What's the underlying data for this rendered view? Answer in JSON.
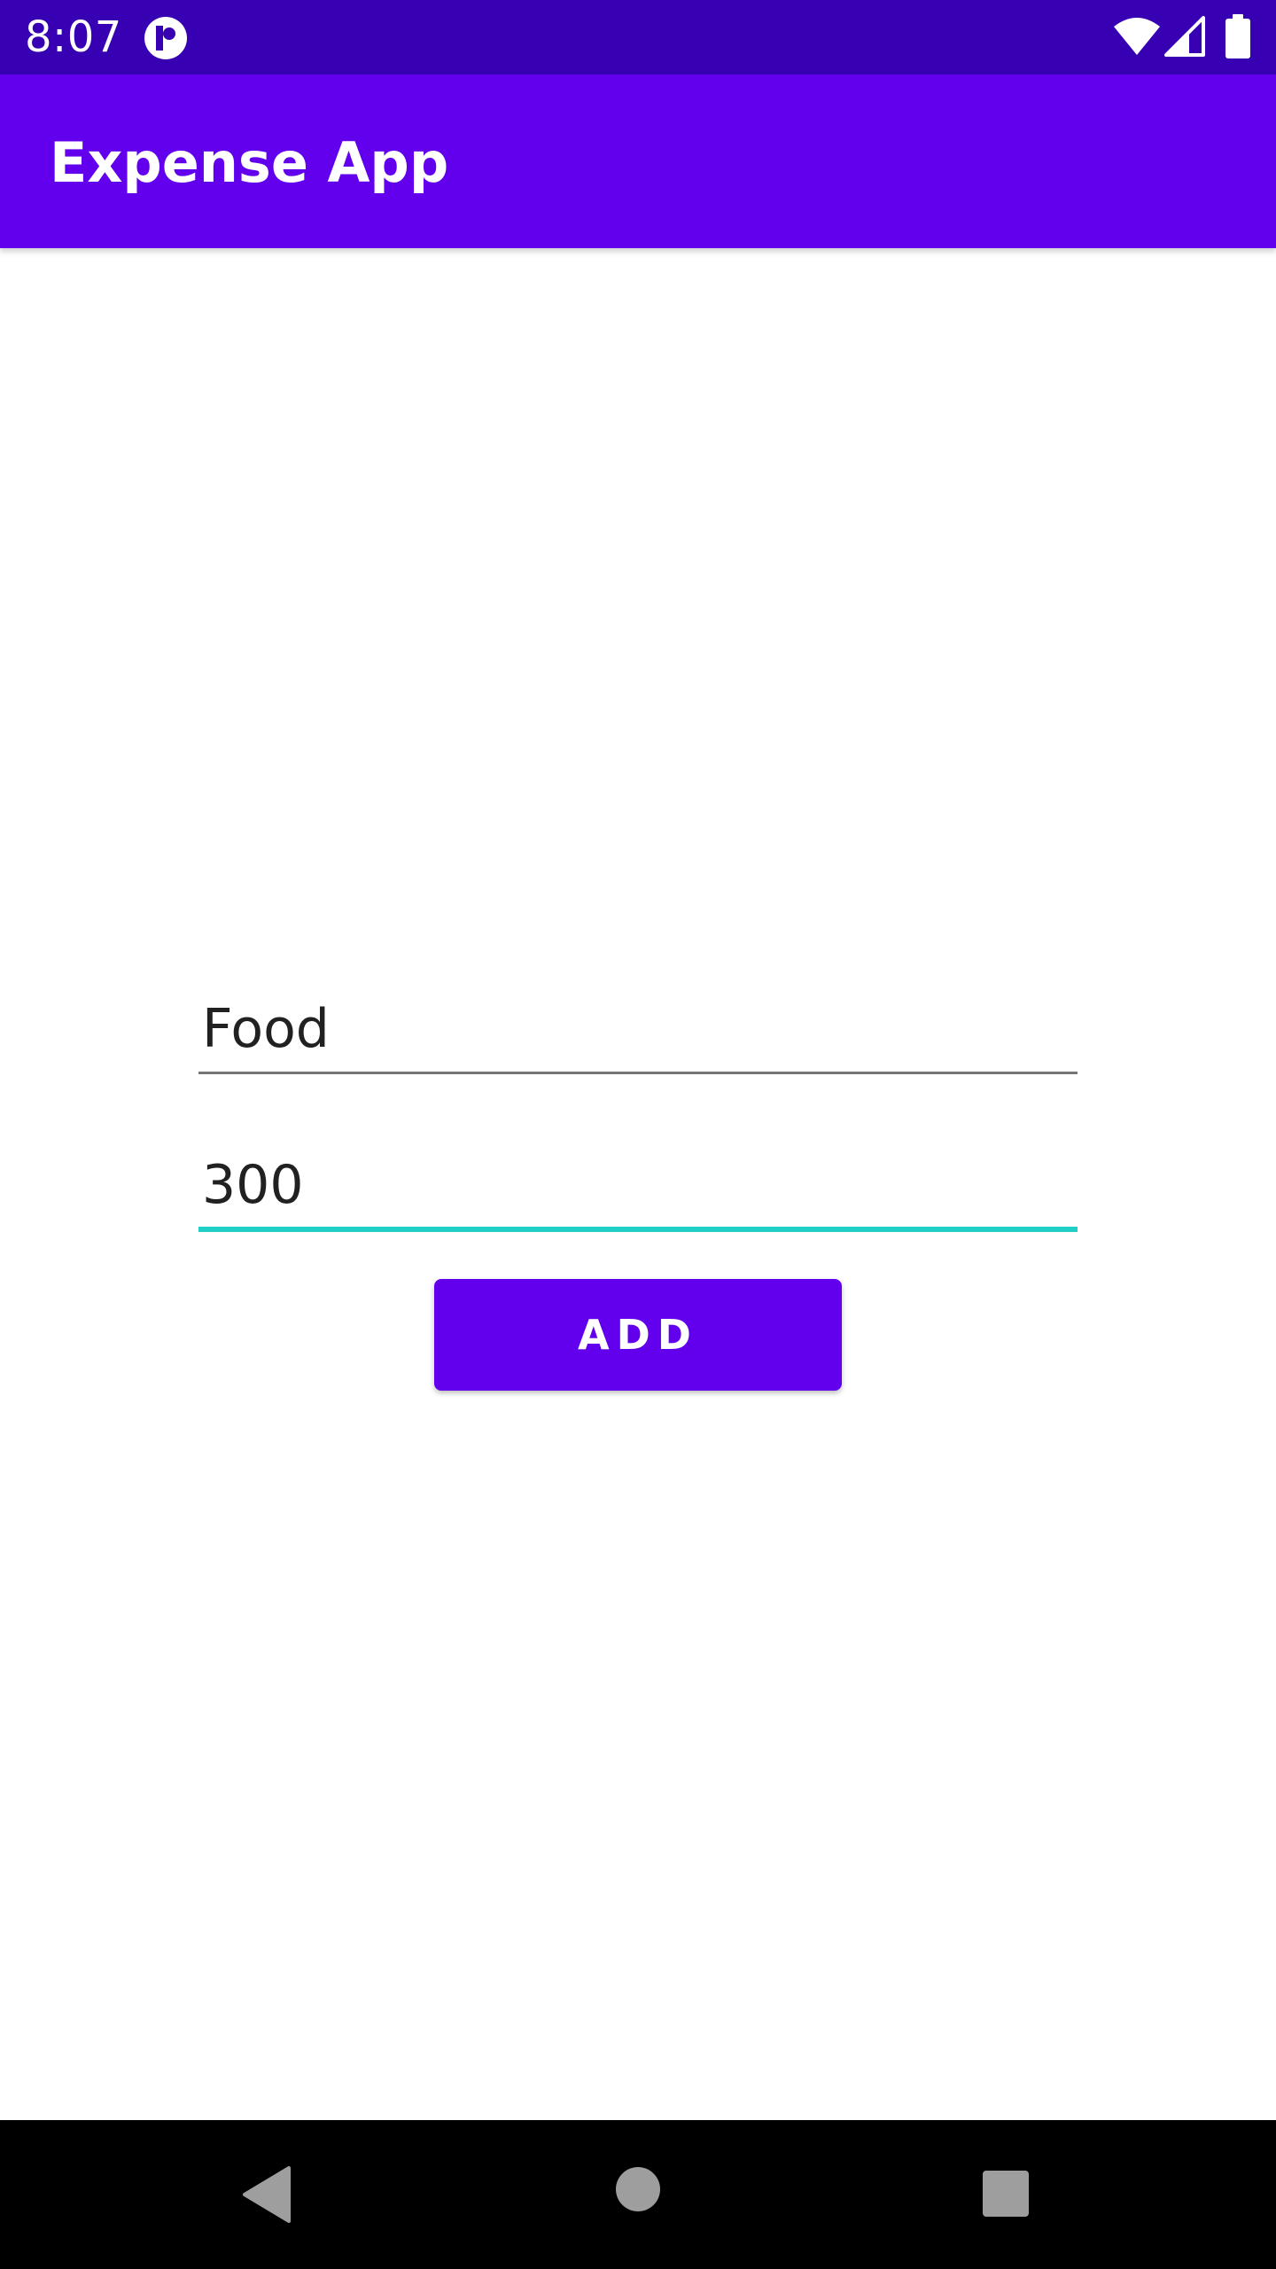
{
  "status_bar": {
    "time": "8:07",
    "icons": [
      "app-notification-icon",
      "wifi-icon",
      "signal-icon",
      "battery-icon"
    ]
  },
  "app_bar": {
    "title": "Expense App"
  },
  "form": {
    "category_value": "Food",
    "amount_value": "300",
    "add_label": "ADD"
  },
  "nav_bar": {
    "icons": [
      "back-icon",
      "home-icon",
      "recents-icon"
    ]
  },
  "colors": {
    "primary": "#6200ee",
    "primary_dark": "#3700b3",
    "accent": "#20d0c8",
    "text": "#212121",
    "nav_background": "#000000"
  }
}
